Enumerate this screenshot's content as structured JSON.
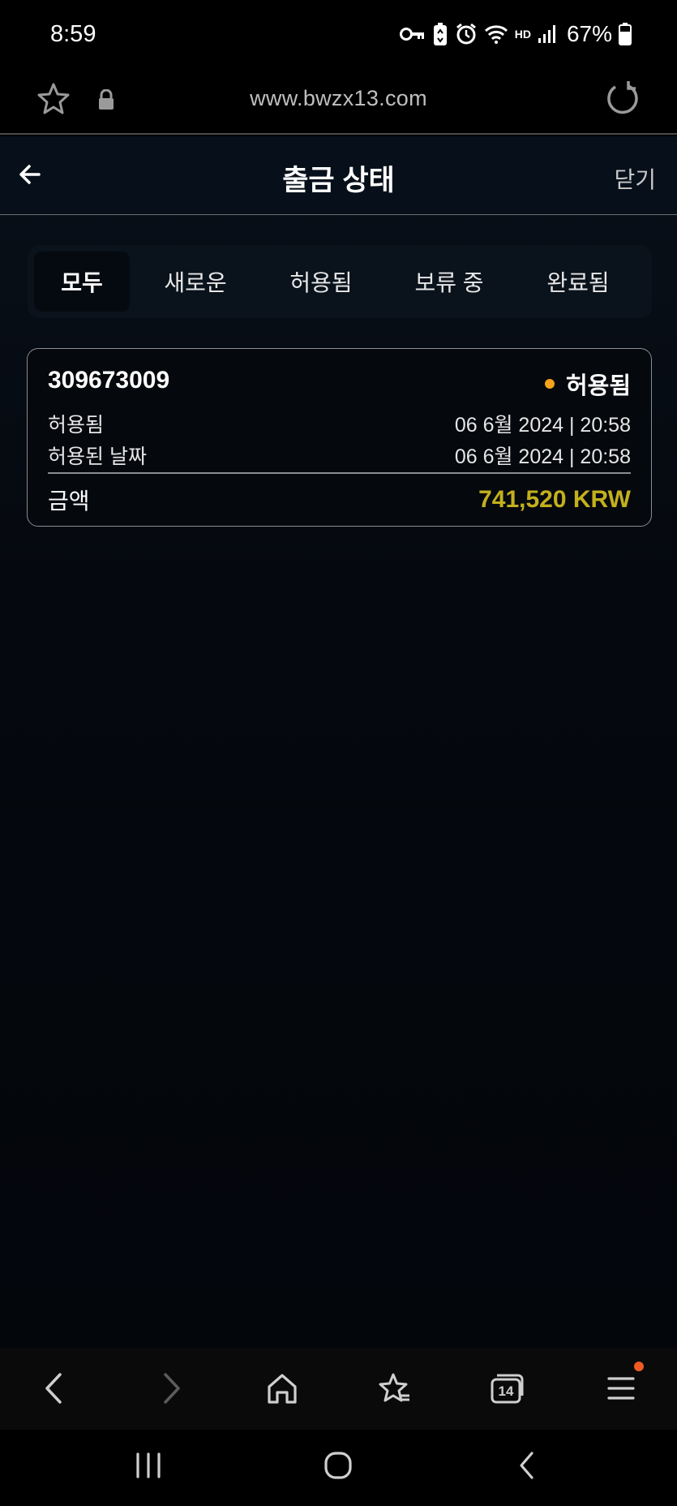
{
  "status_bar": {
    "time": "8:59",
    "network": "HD",
    "battery": "67%",
    "icons": [
      "vpn-key-icon",
      "battery-saver-icon",
      "alarm-icon",
      "wifi-icon",
      "signal-icon",
      "battery-icon"
    ]
  },
  "browser": {
    "url": "www.bwzx13.com",
    "icons": [
      "star-icon",
      "lock-icon",
      "reload-icon"
    ]
  },
  "header": {
    "title": "출금 상태",
    "close_label": "닫기"
  },
  "tabs": [
    {
      "label": "모두",
      "active": true
    },
    {
      "label": "새로운",
      "active": false
    },
    {
      "label": "허용됨",
      "active": false
    },
    {
      "label": "보류 중",
      "active": false
    },
    {
      "label": "완료됨",
      "active": false
    }
  ],
  "withdrawal": {
    "id": "309673009",
    "status": "허용됨",
    "status_color": "#f5a31a",
    "rows": [
      {
        "label": "허용됨",
        "value": "06 6월 2024 | 20:58"
      },
      {
        "label": "허용된 날짜",
        "value": "06 6월 2024 | 20:58"
      }
    ],
    "amount_label": "금액",
    "amount_value": "741,520 KRW",
    "amount_color": "#c3b01d"
  },
  "browser_nav": {
    "tab_count": "14",
    "icons": [
      "back-icon",
      "forward-icon",
      "home-icon",
      "bookmarks-icon",
      "tabs-icon",
      "menu-icon"
    ],
    "notification_color": "#f05a23"
  },
  "system_nav": {
    "icons": [
      "recents-icon",
      "home-circle-icon",
      "system-back-icon"
    ]
  }
}
